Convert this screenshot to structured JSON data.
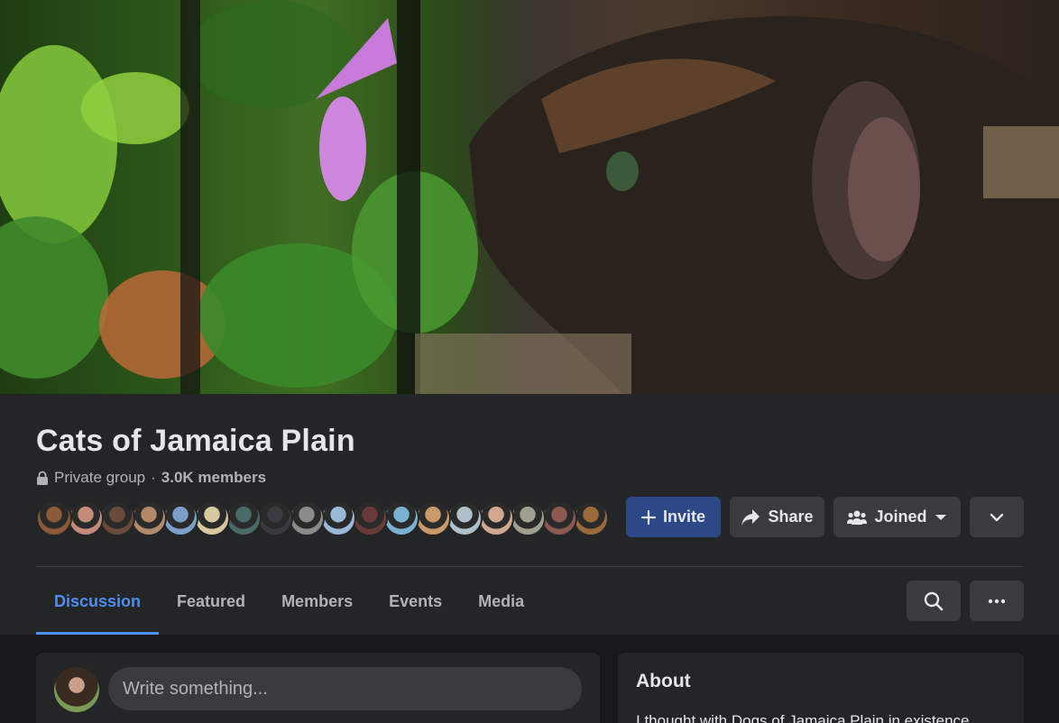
{
  "cover": {
    "description_icon": "cover-photo"
  },
  "group": {
    "title": "Cats of Jamaica Plain",
    "privacy": "Private group",
    "separator": "·",
    "members": "3.0K members"
  },
  "avatars": [
    {
      "color": "#8a5a3a"
    },
    {
      "color": "#c48a7a"
    },
    {
      "color": "#6a4a3a"
    },
    {
      "color": "#b08a6a"
    },
    {
      "color": "#7aa0c8"
    },
    {
      "color": "#d8c8a0"
    },
    {
      "color": "#4a6a6a"
    },
    {
      "color": "#3a3a40"
    },
    {
      "color": "#8a8a8a"
    },
    {
      "color": "#9ab8d8"
    },
    {
      "color": "#6a3a3a"
    },
    {
      "color": "#7ab0d0"
    },
    {
      "color": "#c89a6a"
    },
    {
      "color": "#b0c0c8"
    },
    {
      "color": "#d0a890"
    },
    {
      "color": "#a0a090"
    },
    {
      "color": "#8a5a50"
    },
    {
      "color": "#9a6a3a"
    }
  ],
  "actions": {
    "invite_label": "Invite",
    "share_label": "Share",
    "joined_label": "Joined"
  },
  "tabs": [
    {
      "label": "Discussion"
    },
    {
      "label": "Featured"
    },
    {
      "label": "Members"
    },
    {
      "label": "Events"
    },
    {
      "label": "Media"
    }
  ],
  "composer": {
    "placeholder": "Write something..."
  },
  "about": {
    "title": "About",
    "text": "I thought with Dogs of Jamaica Plain in existence"
  },
  "colors": {
    "accent": "#4d8ef0",
    "invite_bg": "#2d4886",
    "panel": "#242526",
    "page": "#18191a"
  }
}
